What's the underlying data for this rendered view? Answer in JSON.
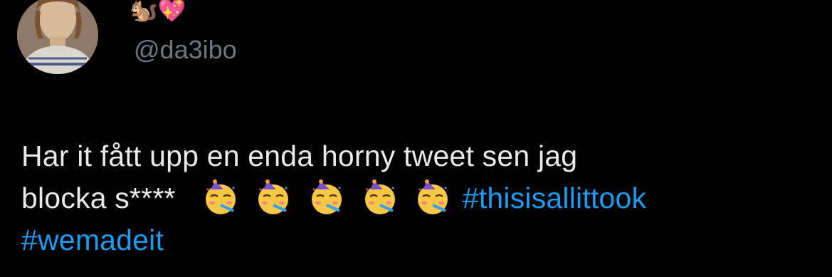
{
  "author": {
    "display_name_emojis": "🐿️💖",
    "handle": "@da3ibo"
  },
  "tweet": {
    "text_line1": "Har it fått upp en enda horny tweet sen jag",
    "text_line2_start": "blocka s****",
    "emojis": [
      "partying-face-emoji",
      "partying-face-emoji",
      "partying-face-emoji",
      "partying-face-emoji",
      "partying-face-emoji"
    ],
    "hashtags": [
      "#thisisallittook",
      "#wemadeit"
    ]
  },
  "colors": {
    "background": "#000000",
    "text": "#e7e9ea",
    "muted": "#71767b",
    "link": "#1d9bf0"
  }
}
